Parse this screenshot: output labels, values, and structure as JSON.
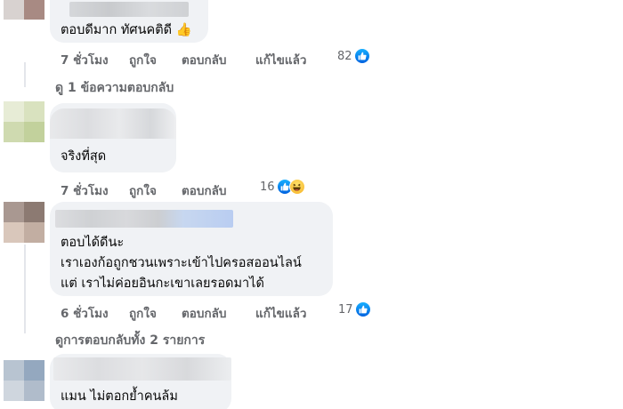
{
  "comments": [
    {
      "text_lines": [
        "ตอบดีมาก ทัศนคติดี"
      ],
      "emoji": "👍",
      "time": "7 ชั่วโมง",
      "like": "ถูกใจ",
      "reply": "ตอบกลับ",
      "edited": "แก้ไขแล้ว",
      "count": "82",
      "reactions": [
        "like"
      ]
    },
    {
      "text_lines": [
        "จริงที่สุด"
      ],
      "time": "7 ชั่วโมง",
      "like": "ถูกใจ",
      "reply": "ตอบกลับ",
      "count": "16",
      "reactions": [
        "like",
        "haha"
      ]
    },
    {
      "text_lines": [
        "ตอบได้ดีนะ",
        "เราเองก้อถูกชวนเพราะเข้าไปครอสออนไลน์",
        "แต่ เราไม่ค่อยอินกะเขาเลยรอดมาได้"
      ],
      "time": "6 ชั่วโมง",
      "like": "ถูกใจ",
      "reply": "ตอบกลับ",
      "edited": "แก้ไขแล้ว",
      "count": "17",
      "reactions": [
        "like"
      ]
    },
    {
      "text_lines": [
        "แมน ไม่ตอกย้ำคนล้ม"
      ]
    }
  ],
  "view_replies": [
    "ดู 1 ข้อความตอบกลับ",
    "ดูการตอบกลับทั้ง 2 รายการ"
  ],
  "colors": {
    "bubble": "#f0f2f5",
    "meta_text": "#65676b",
    "like_blue": "#0866ff"
  }
}
